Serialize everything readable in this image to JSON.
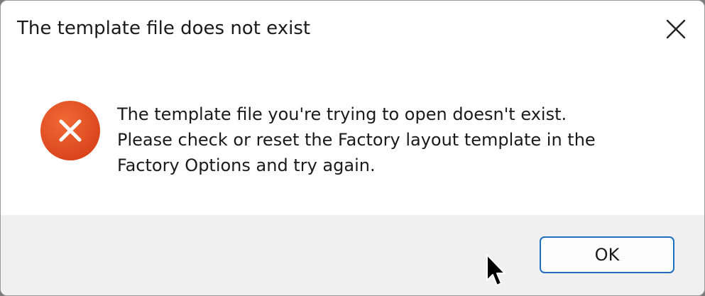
{
  "dialog": {
    "title": "The template file does not exist",
    "close_icon": "close-icon",
    "icon": "error-icon",
    "message_lines": [
      "The template file you're trying to open doesn't exist.",
      "Please check or reset the Factory layout template in the",
      "Factory Options and try again."
    ],
    "ok_label": "OK"
  },
  "colors": {
    "error_red": "#e04a1f",
    "button_border": "#1f6fc0",
    "footer_bg": "#f0f0f0"
  }
}
